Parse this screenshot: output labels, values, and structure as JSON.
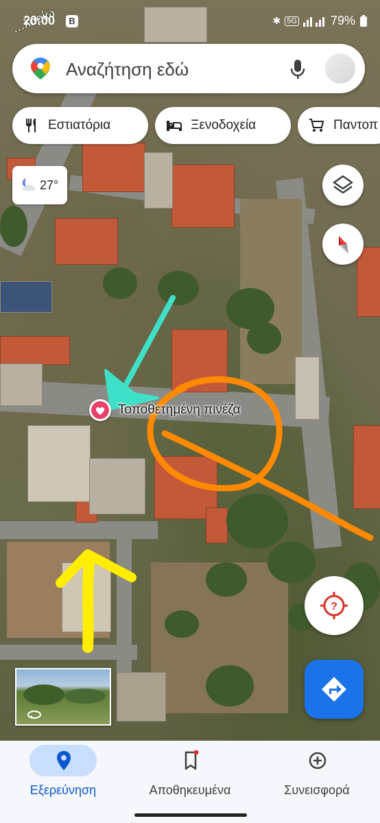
{
  "status_bar": {
    "time": "20:00",
    "notification_badge": "B",
    "network": "5G",
    "battery_percent": "79%"
  },
  "search": {
    "placeholder": "Αναζήτηση εδώ"
  },
  "chips": [
    {
      "label": "Εστιατόρια",
      "icon": "restaurant-icon"
    },
    {
      "label": "Ξενοδοχεία",
      "icon": "hotel-icon"
    },
    {
      "label": "Παντοπ",
      "icon": "shopping-cart-icon"
    }
  ],
  "weather": {
    "temperature": "27°",
    "icon": "partly-cloudy-night-icon"
  },
  "map": {
    "street_label": "…λαρίω",
    "saved_place_label": "Τοποθετημένη πινέζα"
  },
  "bottom_nav": {
    "items": [
      {
        "label": "Εξερεύνηση",
        "icon": "location-pin-icon",
        "active": true
      },
      {
        "label": "Αποθηκευμένα",
        "icon": "bookmark-icon",
        "active": false
      },
      {
        "label": "Συνεισφορά",
        "icon": "add-circle-icon",
        "active": false
      }
    ]
  },
  "colors": {
    "accent": "#1a73e8",
    "active_nav": "#0b57d0",
    "saved_pin": "#e8406a",
    "annotation_cyan": "#3ee0c8",
    "annotation_orange": "#ff8a00",
    "annotation_yellow": "#ffee00"
  }
}
